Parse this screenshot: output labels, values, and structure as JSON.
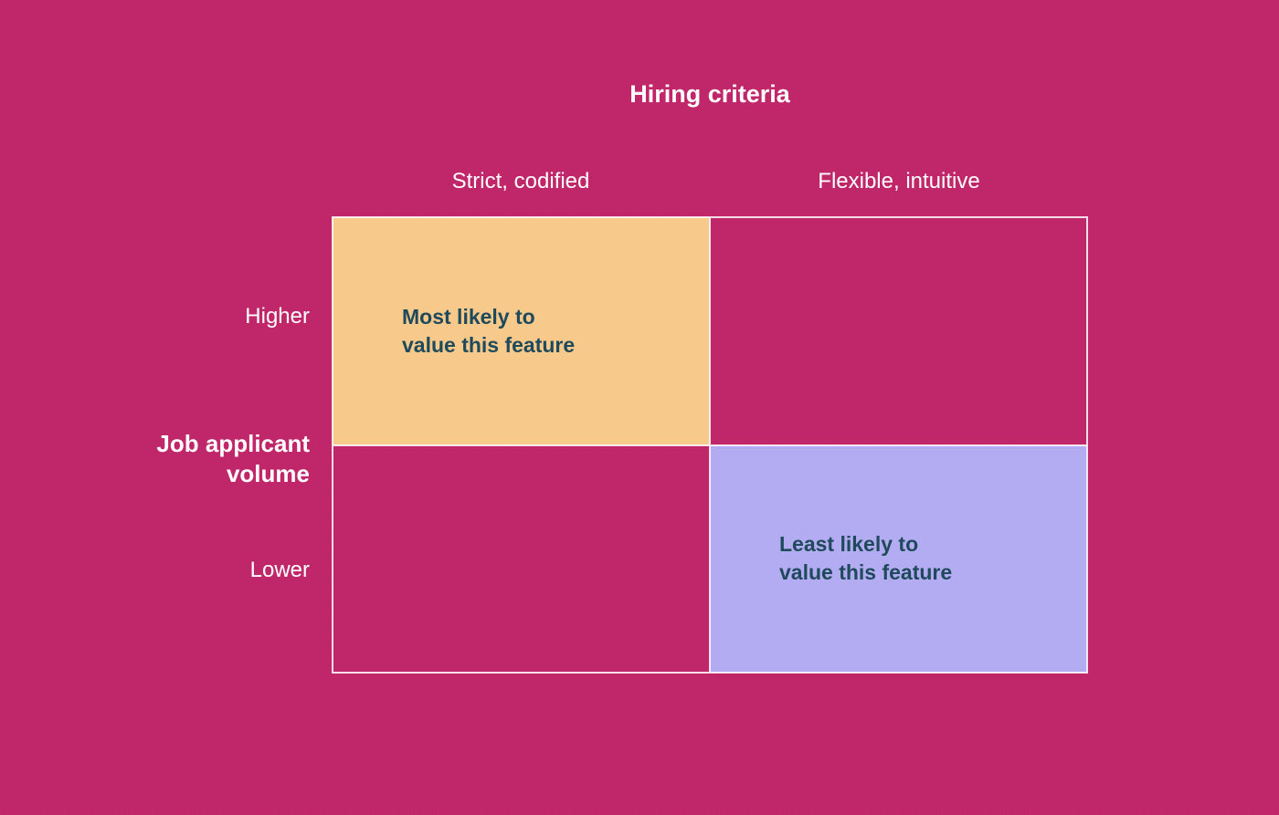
{
  "axes": {
    "x_title": "Hiring criteria",
    "y_title": "Job applicant volume",
    "columns": {
      "left": "Strict, codified",
      "right": "Flexible, intuitive"
    },
    "rows": {
      "top": "Higher",
      "bottom": "Lower"
    }
  },
  "cells": {
    "top_left": {
      "line1": "Most likely to",
      "line2": "value this feature"
    },
    "bottom_right": {
      "line1": "Least likely to",
      "line2": "value this feature"
    }
  },
  "colors": {
    "background": "#c9286e",
    "highlight_warm": "#f7c98a",
    "highlight_cool": "#b3acf2",
    "cell_text": "#1f4a5c",
    "label_text": "#ffffff"
  },
  "chart_data": {
    "type": "table",
    "title": "",
    "x_dimension": "Hiring criteria",
    "y_dimension": "Job applicant volume",
    "columns": [
      "Strict, codified",
      "Flexible, intuitive"
    ],
    "rows": [
      "Higher",
      "Lower"
    ],
    "cells": [
      {
        "row": "Higher",
        "column": "Strict, codified",
        "value": "Most likely to value this feature",
        "highlight": "warm"
      },
      {
        "row": "Higher",
        "column": "Flexible, intuitive",
        "value": "",
        "highlight": null
      },
      {
        "row": "Lower",
        "column": "Strict, codified",
        "value": "",
        "highlight": null
      },
      {
        "row": "Lower",
        "column": "Flexible, intuitive",
        "value": "Least likely to value this feature",
        "highlight": "cool"
      }
    ]
  }
}
